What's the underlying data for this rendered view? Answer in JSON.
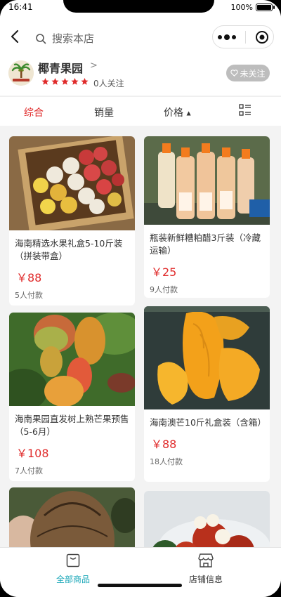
{
  "status": {
    "time": "16:41",
    "battery": "100%"
  },
  "header": {
    "search_placeholder": "搜索本店",
    "shop": {
      "name": "椰青果园",
      "followers": "0人关注",
      "follow_label": "未关注",
      "rating_stars": 5
    }
  },
  "tabs": [
    {
      "label": "综合",
      "active": true
    },
    {
      "label": "销量"
    },
    {
      "label": "价格"
    }
  ],
  "products": [
    {
      "title": "海南精选水果礼盒5-10斤装（拼装带盒）",
      "price": "￥88",
      "paid": "5人付款",
      "image": "fruit-box-image"
    },
    {
      "title": "瓶装新鲜糟粕醋3斤装（冷藏运输）",
      "price": "￥25",
      "paid": "9人付款",
      "image": "vinegar-bottles-image"
    },
    {
      "title": "海南果园直发树上熟芒果预售（5-6月）",
      "price": "￥108",
      "paid": "7人付款",
      "image": "mango-tree-image"
    },
    {
      "title": "海南澳芒10斤礼盒装（含箱）",
      "price": "￥88",
      "paid": "18人付款",
      "image": "peeled-mango-image"
    },
    {
      "title": "",
      "price": "",
      "paid": "",
      "image": "coconut-image"
    },
    {
      "title": "",
      "price": "",
      "paid": "",
      "image": "rambutan-image"
    }
  ],
  "bottom_nav": [
    {
      "label": "全部商品",
      "icon": "bag-icon",
      "active": true
    },
    {
      "label": "店铺信息",
      "icon": "store-icon"
    }
  ],
  "colors": {
    "accent_red": "#e02b2b",
    "active_teal": "#1aa7b8",
    "follow_gray": "#bdbdbd"
  }
}
